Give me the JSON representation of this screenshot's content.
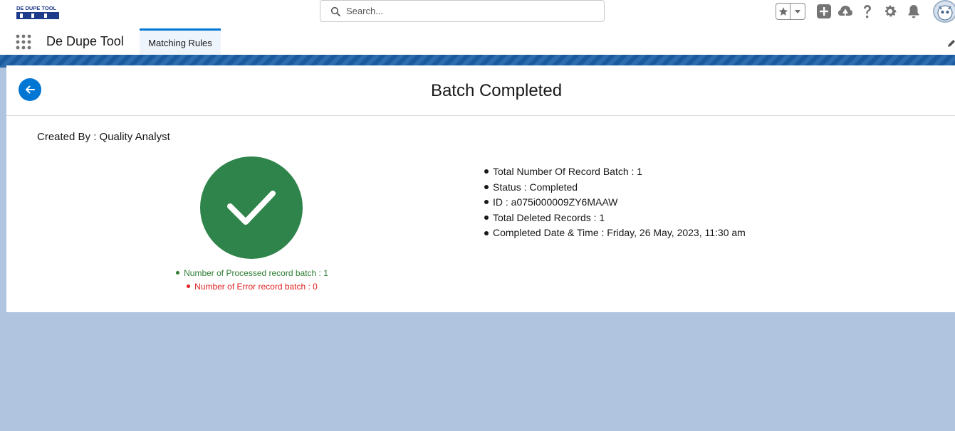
{
  "header": {
    "logo_text": "DE DUPE TOOL",
    "search_placeholder": "Search..."
  },
  "nav": {
    "app_name": "De Dupe Tool",
    "tabs": [
      {
        "label": "Matching Rules",
        "active": true
      }
    ]
  },
  "card": {
    "title": "Batch Completed",
    "created_by": "Created By : Quality Analyst",
    "processed_text": "Number of Processed record batch : 1",
    "error_text": "Number of Error record batch : 0",
    "details": [
      "Total Number Of Record Batch : 1",
      "Status : Completed",
      "ID : a075i000009ZY6MAAW",
      "Total Deleted Records : 1",
      "Completed Date & Time : Friday, 26 May, 2023, 11:30 am"
    ]
  },
  "colors": {
    "brand_blue": "#0176d3",
    "success_green": "#2e844a",
    "error_red": "#e02020",
    "background": "#b0c4df"
  },
  "icons": [
    "search-icon",
    "favorite-star-icon",
    "favorites-dropdown-icon",
    "add-icon",
    "trailhead-icon",
    "help-icon",
    "setup-gear-icon",
    "notification-bell-icon",
    "app-launcher-icon",
    "edit-pencil-icon",
    "back-arrow-icon",
    "checkmark-icon"
  ]
}
